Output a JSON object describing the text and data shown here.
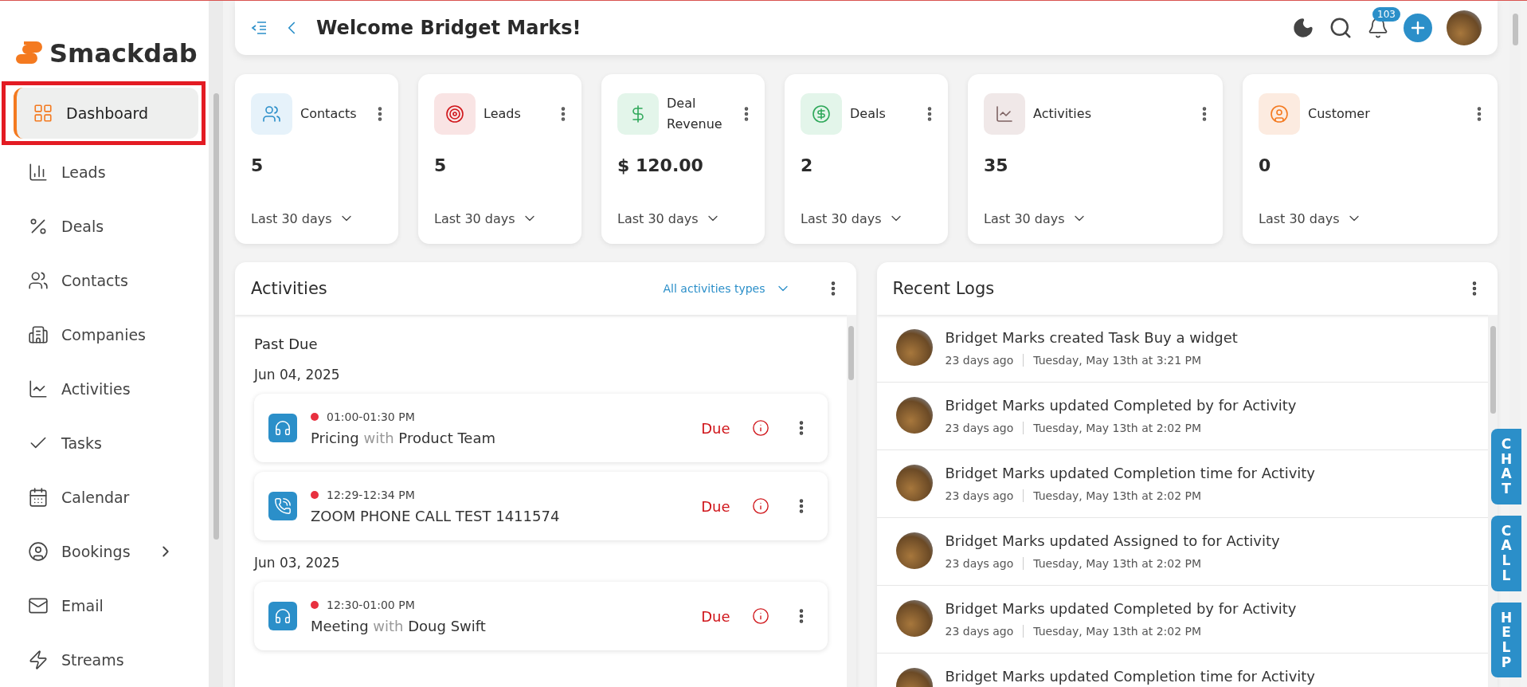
{
  "brand": {
    "name": "Smackdab"
  },
  "sidebar": {
    "items": [
      {
        "label": "Dashboard",
        "selected": true,
        "expandable": false
      },
      {
        "label": "Leads",
        "selected": false,
        "expandable": false
      },
      {
        "label": "Deals",
        "selected": false,
        "expandable": false
      },
      {
        "label": "Contacts",
        "selected": false,
        "expandable": false
      },
      {
        "label": "Companies",
        "selected": false,
        "expandable": false
      },
      {
        "label": "Activities",
        "selected": false,
        "expandable": false
      },
      {
        "label": "Tasks",
        "selected": false,
        "expandable": false
      },
      {
        "label": "Calendar",
        "selected": false,
        "expandable": false
      },
      {
        "label": "Bookings",
        "selected": false,
        "expandable": true
      },
      {
        "label": "Email",
        "selected": false,
        "expandable": false
      },
      {
        "label": "Streams",
        "selected": false,
        "expandable": false
      }
    ]
  },
  "header": {
    "title": "Welcome Bridget Marks!",
    "notification_count": "103"
  },
  "stat_cards": [
    {
      "title": "Contacts",
      "value": "5",
      "period": "Last 30 days"
    },
    {
      "title": "Leads",
      "value": "5",
      "period": "Last 30 days"
    },
    {
      "title": "Deal Revenue",
      "value": "$ 120.00",
      "period": "Last 30 days"
    },
    {
      "title": "Deals",
      "value": "2",
      "period": "Last 30 days"
    },
    {
      "title": "Activities",
      "value": "35",
      "period": "Last 30 days"
    },
    {
      "title": "Customer",
      "value": "0",
      "period": "Last 30 days"
    }
  ],
  "activities": {
    "title": "Activities",
    "filter": "All activities types",
    "section": "Past Due",
    "groups": [
      {
        "date": "Jun 04, 2025",
        "items": [
          {
            "kind": "meeting",
            "time": "01:00-01:30 PM",
            "subject": "Pricing",
            "with": "with",
            "party": "Product Team",
            "status": "Due"
          },
          {
            "kind": "call",
            "time": "12:29-12:34 PM",
            "subject": "ZOOM PHONE CALL TEST 1411574",
            "status": "Due"
          }
        ]
      },
      {
        "date": "Jun 03, 2025",
        "items": [
          {
            "kind": "meeting",
            "time": "12:30-01:00 PM",
            "subject": "Meeting",
            "with": "with",
            "party": "Doug Swift",
            "status": "Due"
          }
        ]
      }
    ]
  },
  "logs": {
    "title": "Recent Logs",
    "entries": [
      {
        "text": "Bridget Marks created Task Buy a widget",
        "ago": "23 days ago",
        "when": "Tuesday, May 13th at 3:21 PM"
      },
      {
        "text": "Bridget Marks updated Completed by for Activity",
        "ago": "23 days ago",
        "when": "Tuesday, May 13th at 2:02 PM"
      },
      {
        "text": "Bridget Marks updated Completion time for Activity",
        "ago": "23 days ago",
        "when": "Tuesday, May 13th at 2:02 PM"
      },
      {
        "text": "Bridget Marks updated Assigned to for Activity",
        "ago": "23 days ago",
        "when": "Tuesday, May 13th at 2:02 PM"
      },
      {
        "text": "Bridget Marks updated Completed by for Activity",
        "ago": "23 days ago",
        "when": "Tuesday, May 13th at 2:02 PM"
      },
      {
        "text": "Bridget Marks updated Completion time for Activity"
      }
    ]
  },
  "side_tabs": [
    "CHAT",
    "CALL",
    "HELP"
  ]
}
